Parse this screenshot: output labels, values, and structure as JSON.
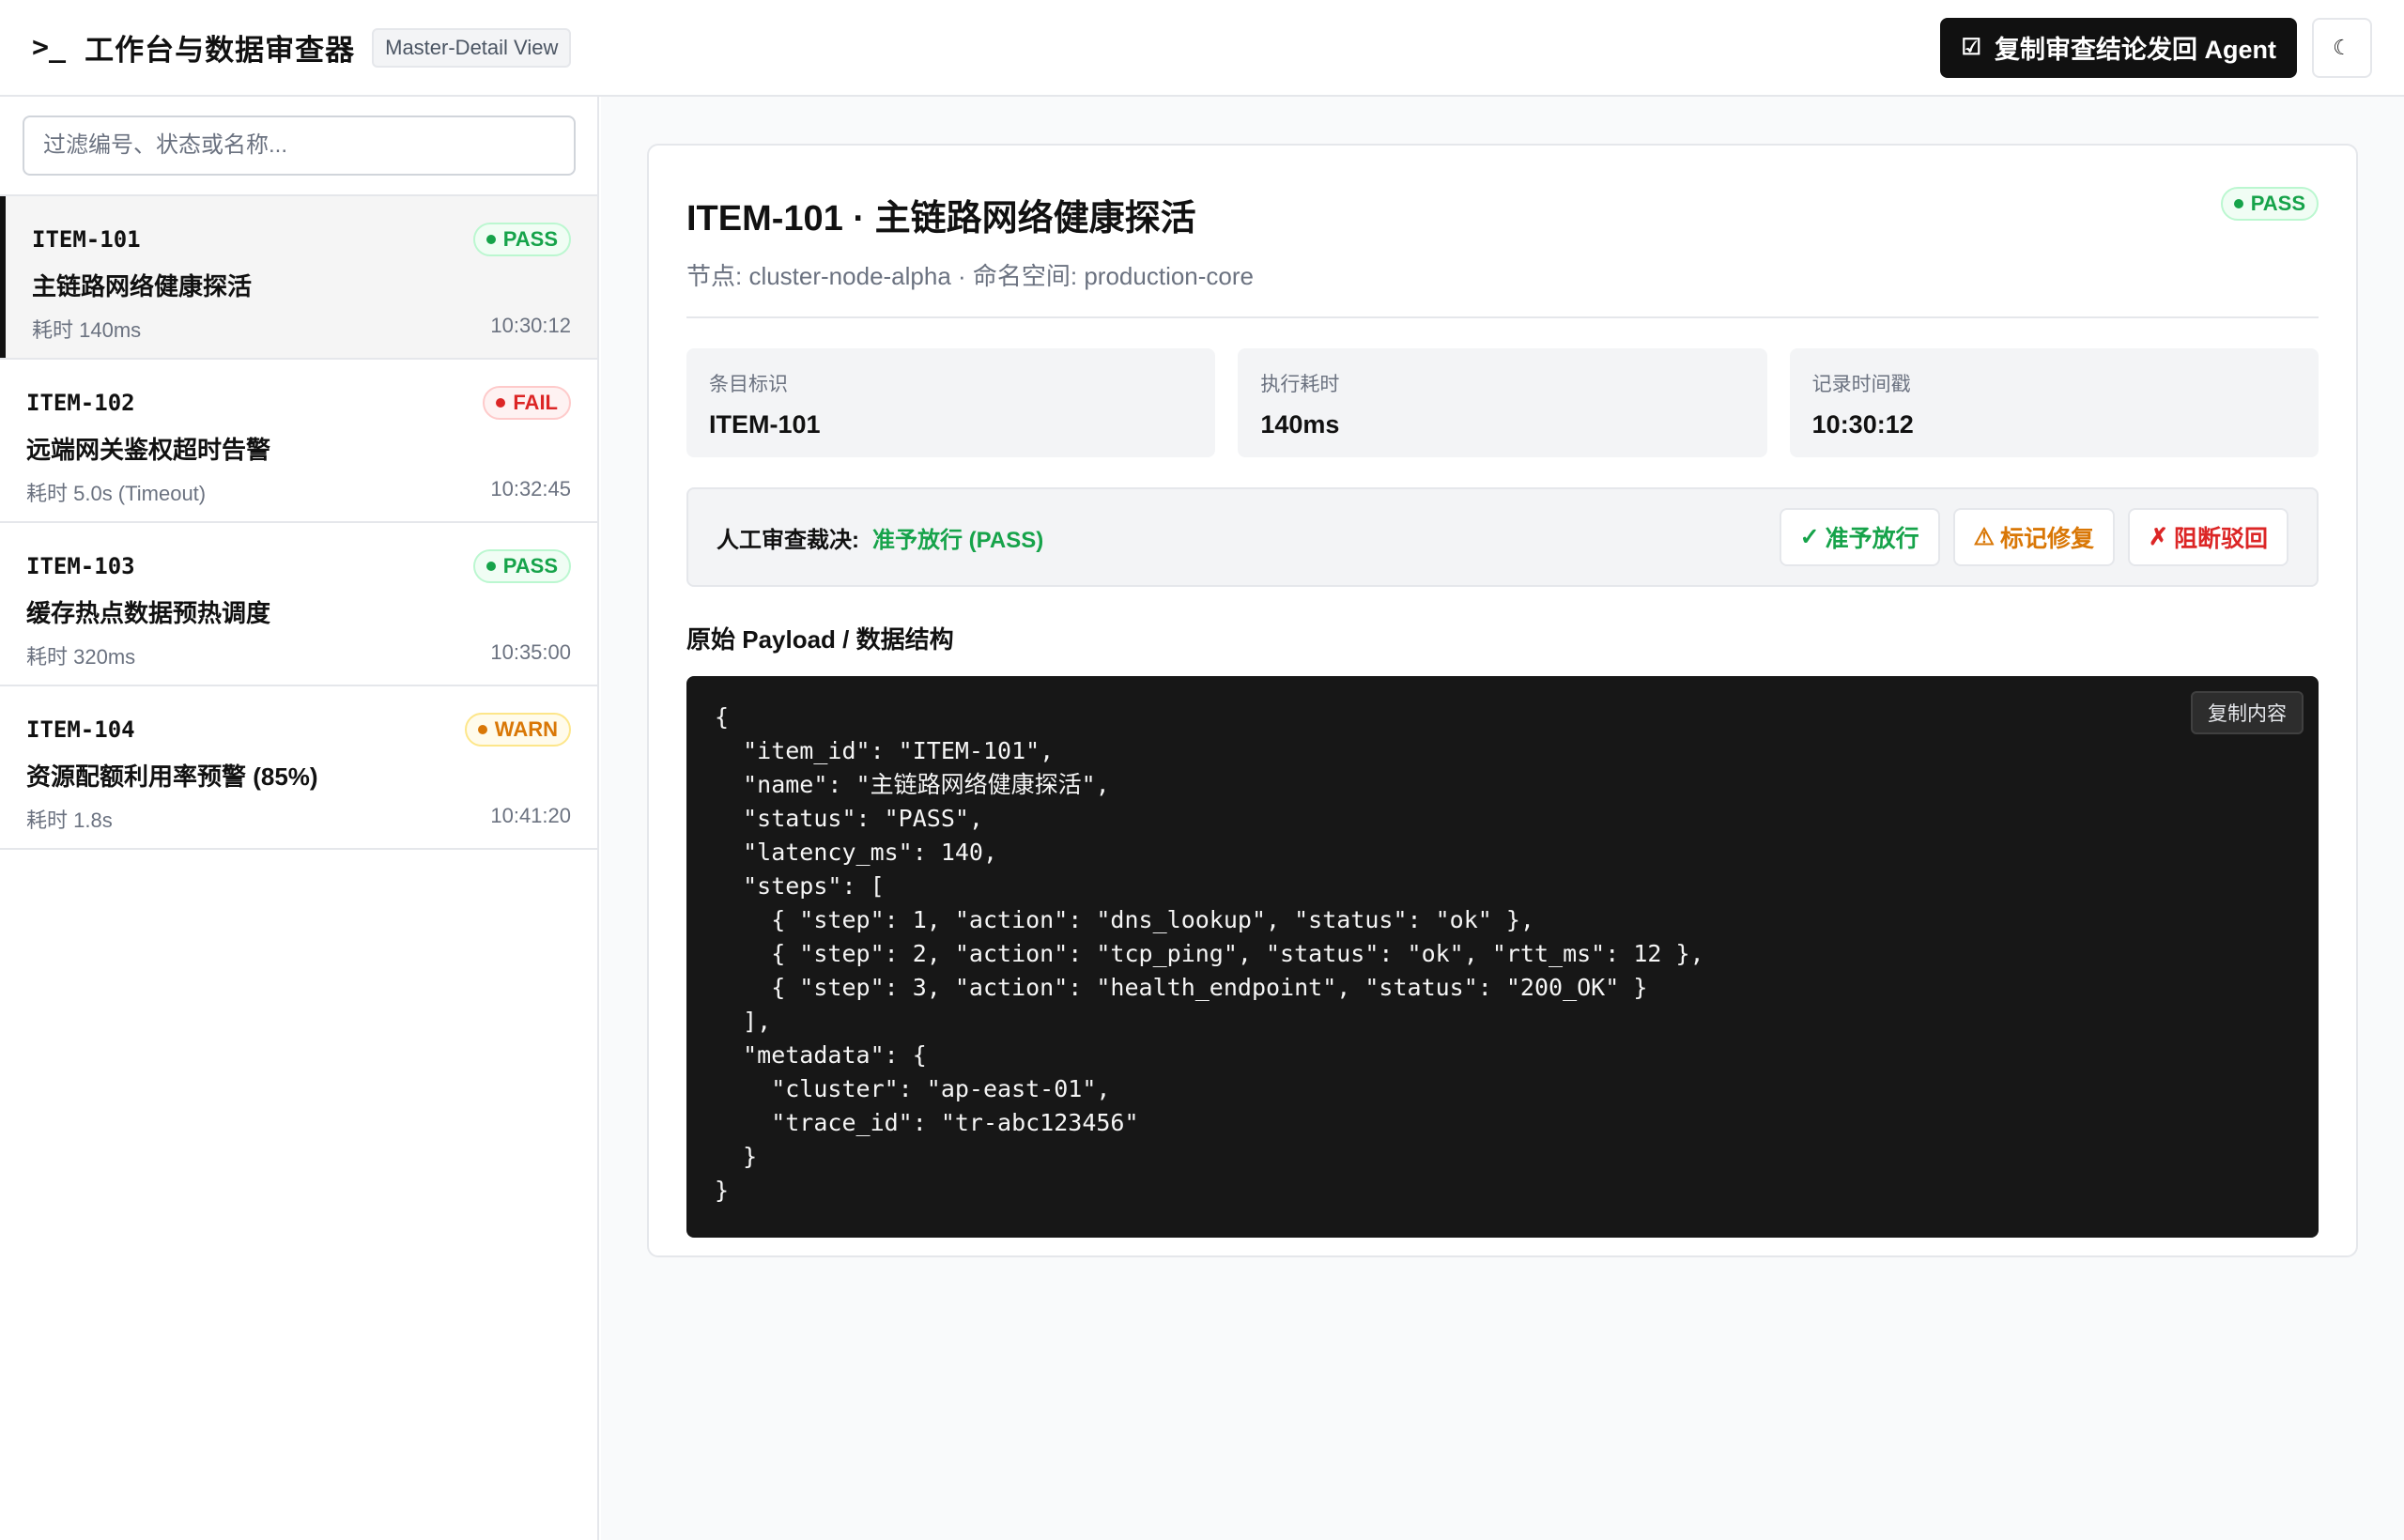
{
  "header": {
    "logo_glyph": ">_",
    "title": "工作台与数据审查器",
    "view_badge": "Master-Detail View",
    "copy_agent_label": "复制审查结论发回 Agent",
    "copy_agent_icon": "☑",
    "theme_icon": "☾"
  },
  "sidebar": {
    "filter_placeholder": "过滤编号、状态或名称...",
    "items": [
      {
        "id": "ITEM-101",
        "status": "PASS",
        "name": "主链路网络健康探活",
        "latency": "耗时 140ms",
        "time": "10:30:12",
        "active": true
      },
      {
        "id": "ITEM-102",
        "status": "FAIL",
        "name": "远端网关鉴权超时告警",
        "latency": "耗时 5.0s (Timeout)",
        "time": "10:32:45",
        "active": false
      },
      {
        "id": "ITEM-103",
        "status": "PASS",
        "name": "缓存热点数据预热调度",
        "latency": "耗时 320ms",
        "time": "10:35:00",
        "active": false
      },
      {
        "id": "ITEM-104",
        "status": "WARN",
        "name": "资源配额利用率预警 (85%)",
        "latency": "耗时 1.8s",
        "time": "10:41:20",
        "active": false
      }
    ]
  },
  "detail": {
    "title": "ITEM-101 · 主链路网络健康探活",
    "subtitle": "节点: cluster-node-alpha · 命名空间: production-core",
    "status": "PASS",
    "stats": [
      {
        "label": "条目标识",
        "value": "ITEM-101"
      },
      {
        "label": "执行耗时",
        "value": "140ms"
      },
      {
        "label": "记录时间戳",
        "value": "10:30:12"
      }
    ],
    "verdict_label": "人工审查裁决:",
    "verdict_value": "准予放行 (PASS)",
    "actions": {
      "approve": {
        "icon": "✓",
        "label": "准予放行"
      },
      "fix": {
        "icon": "⚠",
        "label": "标记修复"
      },
      "reject": {
        "icon": "✗",
        "label": "阻断驳回"
      }
    },
    "payload_title": "原始 Payload / 数据结构",
    "copy_code_label": "复制内容",
    "payload": "{\n  \"item_id\": \"ITEM-101\",\n  \"name\": \"主链路网络健康探活\",\n  \"status\": \"PASS\",\n  \"latency_ms\": 140,\n  \"steps\": [\n    { \"step\": 1, \"action\": \"dns_lookup\", \"status\": \"ok\" },\n    { \"step\": 2, \"action\": \"tcp_ping\", \"status\": \"ok\", \"rtt_ms\": 12 },\n    { \"step\": 3, \"action\": \"health_endpoint\", \"status\": \"200_OK\" }\n  ],\n  \"metadata\": {\n    \"cluster\": \"ap-east-01\",\n    \"trace_id\": \"tr-abc123456\"\n  }\n}"
  },
  "colors": {
    "pass": "#16a34a",
    "fail": "#dc2626",
    "warn": "#d97706",
    "primary": "#111111"
  }
}
